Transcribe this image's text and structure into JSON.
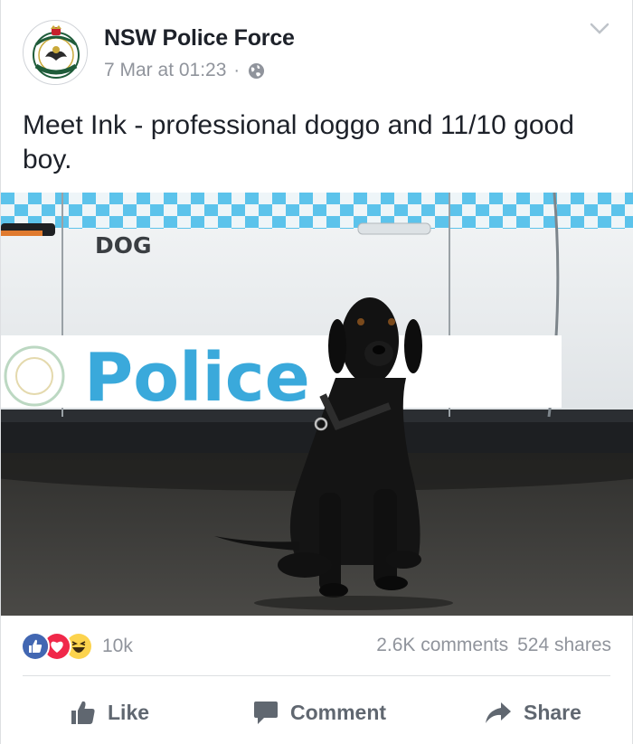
{
  "post": {
    "page_name": "NSW Police Force",
    "timestamp": "7 Mar at 01:23",
    "separator": "·",
    "audience_icon": "globe-icon",
    "text": "Meet Ink - professional doggo and 11/10 good boy.",
    "photo": {
      "vehicle_label": "DOG",
      "vehicle_livery_text": "Police",
      "colors": {
        "livery_blue": "#3aa9db",
        "checker_blue": "#5cc3eb",
        "car_white": "#eef1f3"
      }
    }
  },
  "reactions": {
    "icons": [
      "like-reaction-icon",
      "love-reaction-icon",
      "haha-reaction-icon"
    ],
    "count": "10k"
  },
  "counts": {
    "comments": "2.6K comments",
    "shares": "524 shares"
  },
  "actions": {
    "like": "Like",
    "comment": "Comment",
    "share": "Share"
  },
  "colors": {
    "accent": "#4267b2",
    "text_primary": "#1d2129",
    "text_secondary": "#90949c",
    "action_grey": "#606770",
    "love_red": "#f0284a",
    "haha_yellow": "#fcd34d"
  }
}
